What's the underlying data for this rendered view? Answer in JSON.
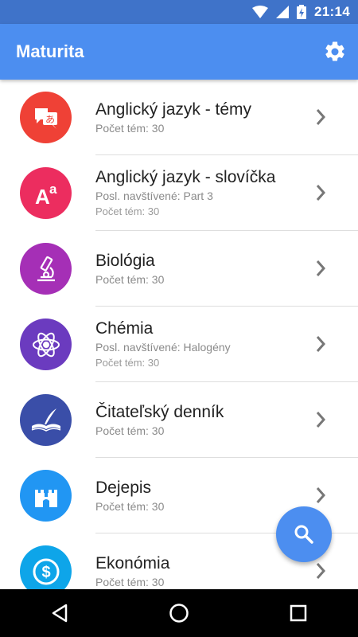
{
  "status_bar": {
    "time": "21:14"
  },
  "app_bar": {
    "title": "Maturita"
  },
  "items": [
    {
      "name": "Anglický jazyk - témy",
      "line1": "Počet tém: 30",
      "line2": "",
      "color": "#ef4136",
      "icon": "translate-icon"
    },
    {
      "name": "Anglický jazyk - slovíčka",
      "line1": "Posl. navštívené: Part 3",
      "line2": "Počet tém: 30",
      "color": "#ec2d5f",
      "icon": "font-size-icon"
    },
    {
      "name": "Biológia",
      "line1": "Počet tém: 30",
      "line2": "",
      "color": "#a52fb6",
      "icon": "microscope-icon"
    },
    {
      "name": "Chémia",
      "line1": "Posl. navštívené: Halogény",
      "line2": "Počet tém: 30",
      "color": "#6b3bbf",
      "icon": "atom-icon"
    },
    {
      "name": "Čitateľský denník",
      "line1": "Počet tém: 30",
      "line2": "",
      "color": "#3a4ea8",
      "icon": "book-quill-icon"
    },
    {
      "name": "Dejepis",
      "line1": "Počet tém: 30",
      "line2": "",
      "color": "#2196f3",
      "icon": "castle-icon"
    },
    {
      "name": "Ekonómia",
      "line1": "Počet tém: 30",
      "line2": "",
      "color": "#0ea5e9",
      "icon": "dollar-icon"
    }
  ],
  "colors": {
    "status_bar": "#3f73c9",
    "app_bar": "#4c8ef0",
    "fab": "#4c8ef0"
  }
}
